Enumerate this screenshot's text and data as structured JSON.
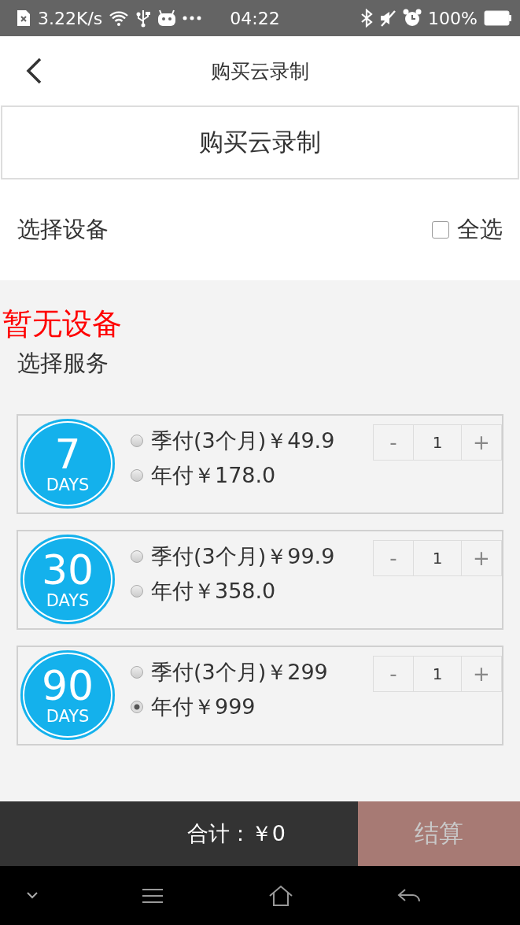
{
  "status_bar": {
    "speed": "3.22K/s",
    "time": "04:22",
    "battery": "100%"
  },
  "header": {
    "title": "购买云录制"
  },
  "banner": {
    "title": "购买云录制"
  },
  "device_row": {
    "label": "选择设备",
    "select_all": {
      "label": "全选",
      "checked": false
    }
  },
  "empty_message": "暂无设备",
  "service_label": "选择服务",
  "plans": [
    {
      "days": "7",
      "unit": "DAYS",
      "options": [
        {
          "label": "季付(3个月)￥49.9",
          "selected": false
        },
        {
          "label": "年付￥178.0",
          "selected": false
        }
      ],
      "minus": "-",
      "quantity": "1",
      "plus": "+"
    },
    {
      "days": "30",
      "unit": "DAYS",
      "options": [
        {
          "label": "季付(3个月)￥99.9",
          "selected": false
        },
        {
          "label": "年付￥358.0",
          "selected": false
        }
      ],
      "minus": "-",
      "quantity": "1",
      "plus": "+"
    },
    {
      "days": "90",
      "unit": "DAYS",
      "options": [
        {
          "label": "季付(3个月)￥299",
          "selected": false
        },
        {
          "label": "年付￥999",
          "selected": true
        }
      ],
      "minus": "-",
      "quantity": "1",
      "plus": "+"
    }
  ],
  "footer": {
    "total": "合计：￥0",
    "checkout": {
      "label": "结算",
      "disabled": true
    }
  }
}
